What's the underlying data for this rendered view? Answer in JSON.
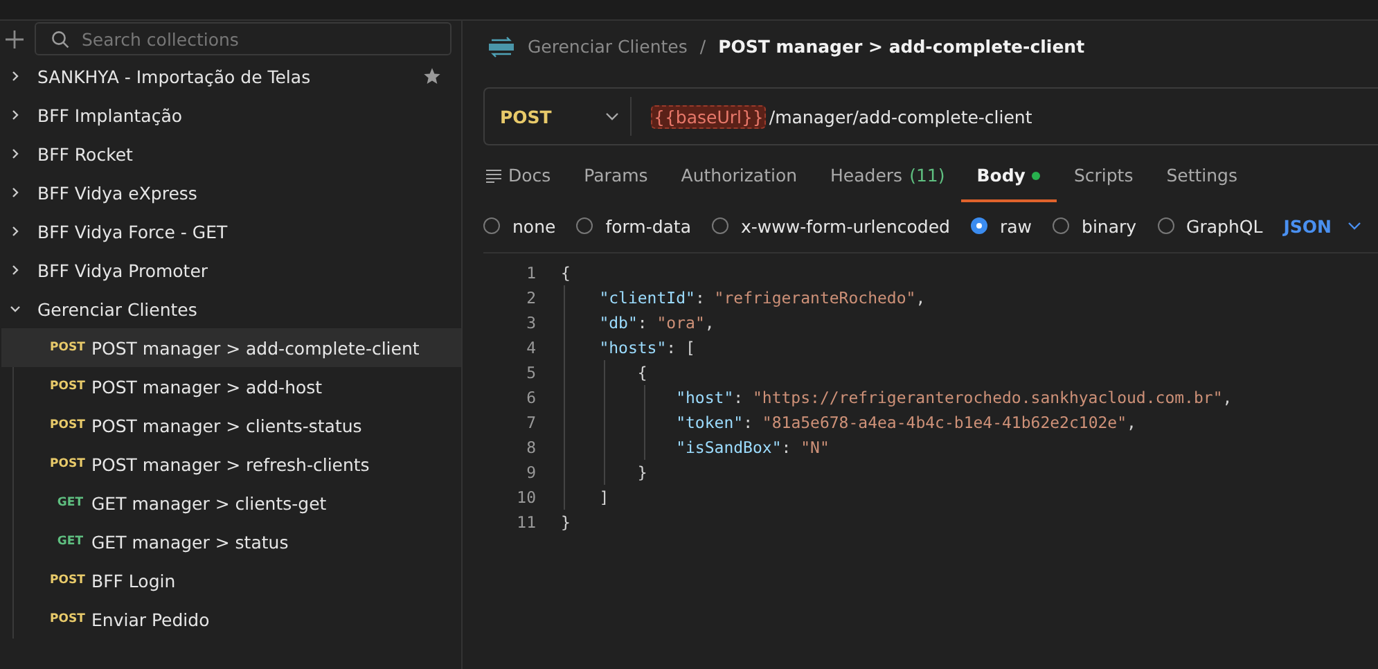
{
  "sidebar": {
    "search": {
      "placeholder": "Search collections"
    },
    "collections": [
      {
        "name": "SANKHYA - Importação de Telas",
        "expanded": false,
        "starred": true
      },
      {
        "name": "BFF Implantação",
        "expanded": false
      },
      {
        "name": "BFF Rocket",
        "expanded": false
      },
      {
        "name": "BFF Vidya eXpress",
        "expanded": false
      },
      {
        "name": "BFF Vidya Force - GET",
        "expanded": false
      },
      {
        "name": "BFF Vidya Promoter",
        "expanded": false
      },
      {
        "name": "Gerenciar Clientes",
        "expanded": true,
        "children": [
          {
            "method": "POST",
            "kind": "post",
            "name": "POST manager > add-complete-client",
            "selected": true
          },
          {
            "method": "POST",
            "kind": "post",
            "name": "POST manager > add-host",
            "selected": false
          },
          {
            "method": "POST",
            "kind": "post",
            "name": "POST manager > clients-status",
            "selected": false
          },
          {
            "method": "POST",
            "kind": "post",
            "name": "POST manager > refresh-clients",
            "selected": false
          },
          {
            "method": "GET",
            "kind": "get",
            "name": "GET manager > clients-get",
            "selected": false
          },
          {
            "method": "GET",
            "kind": "get",
            "name": "GET manager > status",
            "selected": false
          },
          {
            "method": "POST",
            "kind": "post",
            "name": "BFF Login",
            "selected": false
          },
          {
            "method": "POST",
            "kind": "post",
            "name": "Enviar Pedido",
            "selected": false
          }
        ]
      }
    ]
  },
  "request": {
    "breadcrumb": {
      "parent": "Gerenciar Clientes",
      "separator": "/",
      "title": "POST manager > add-complete-client"
    },
    "method": "POST",
    "url_variable": "{{baseUrl}}",
    "url_path": "/manager/add-complete-client",
    "tabs": [
      {
        "label": "Docs",
        "kind": "docs",
        "selected": false
      },
      {
        "label": "Params",
        "selected": false
      },
      {
        "label": "Authorization",
        "selected": false
      },
      {
        "label": "Headers",
        "count": "(11)",
        "selected": false
      },
      {
        "label": "Body",
        "selected": true,
        "has_content": true
      },
      {
        "label": "Scripts",
        "selected": false
      },
      {
        "label": "Settings",
        "selected": false
      }
    ],
    "body_types": [
      {
        "label": "none",
        "selected": false
      },
      {
        "label": "form-data",
        "selected": false
      },
      {
        "label": "x-www-form-urlencoded",
        "selected": false
      },
      {
        "label": "raw",
        "selected": true
      },
      {
        "label": "binary",
        "selected": false
      },
      {
        "label": "GraphQL",
        "selected": false
      }
    ],
    "format": "JSON",
    "code": [
      {
        "number": "1",
        "tokens": [
          {
            "kind": "punct",
            "text": "{"
          }
        ]
      },
      {
        "number": "2",
        "tokens": [
          {
            "kind": "key",
            "text": "    \"clientId\""
          },
          {
            "kind": "punct",
            "text": ": "
          },
          {
            "kind": "string",
            "text": "\"refrigeranteRochedo\""
          },
          {
            "kind": "punct",
            "text": ","
          }
        ]
      },
      {
        "number": "3",
        "tokens": [
          {
            "kind": "key",
            "text": "    \"db\""
          },
          {
            "kind": "punct",
            "text": ": "
          },
          {
            "kind": "string",
            "text": "\"ora\""
          },
          {
            "kind": "punct",
            "text": ","
          }
        ]
      },
      {
        "number": "4",
        "tokens": [
          {
            "kind": "key",
            "text": "    \"hosts\""
          },
          {
            "kind": "punct",
            "text": ": ["
          }
        ]
      },
      {
        "number": "5",
        "tokens": [
          {
            "kind": "punct",
            "text": "        {"
          }
        ]
      },
      {
        "number": "6",
        "tokens": [
          {
            "kind": "key",
            "text": "            \"host\""
          },
          {
            "kind": "punct",
            "text": ": "
          },
          {
            "kind": "string",
            "text": "\"https://refrigeranterochedo.sankhyacloud.com.br\""
          },
          {
            "kind": "punct",
            "text": ","
          }
        ]
      },
      {
        "number": "7",
        "tokens": [
          {
            "kind": "key",
            "text": "            \"token\""
          },
          {
            "kind": "punct",
            "text": ": "
          },
          {
            "kind": "string",
            "text": "\"81a5e678-a4ea-4b4c-b1e4-41b62e2c102e\""
          },
          {
            "kind": "punct",
            "text": ","
          }
        ]
      },
      {
        "number": "8",
        "tokens": [
          {
            "kind": "key",
            "text": "            \"isSandBox\""
          },
          {
            "kind": "punct",
            "text": ": "
          },
          {
            "kind": "string",
            "text": "\"N\""
          }
        ]
      },
      {
        "number": "9",
        "tokens": [
          {
            "kind": "punct",
            "text": "        }"
          }
        ]
      },
      {
        "number": "10",
        "tokens": [
          {
            "kind": "punct",
            "text": "    ]"
          }
        ]
      },
      {
        "number": "11",
        "tokens": [
          {
            "kind": "punct",
            "text": "}"
          }
        ]
      }
    ]
  }
}
